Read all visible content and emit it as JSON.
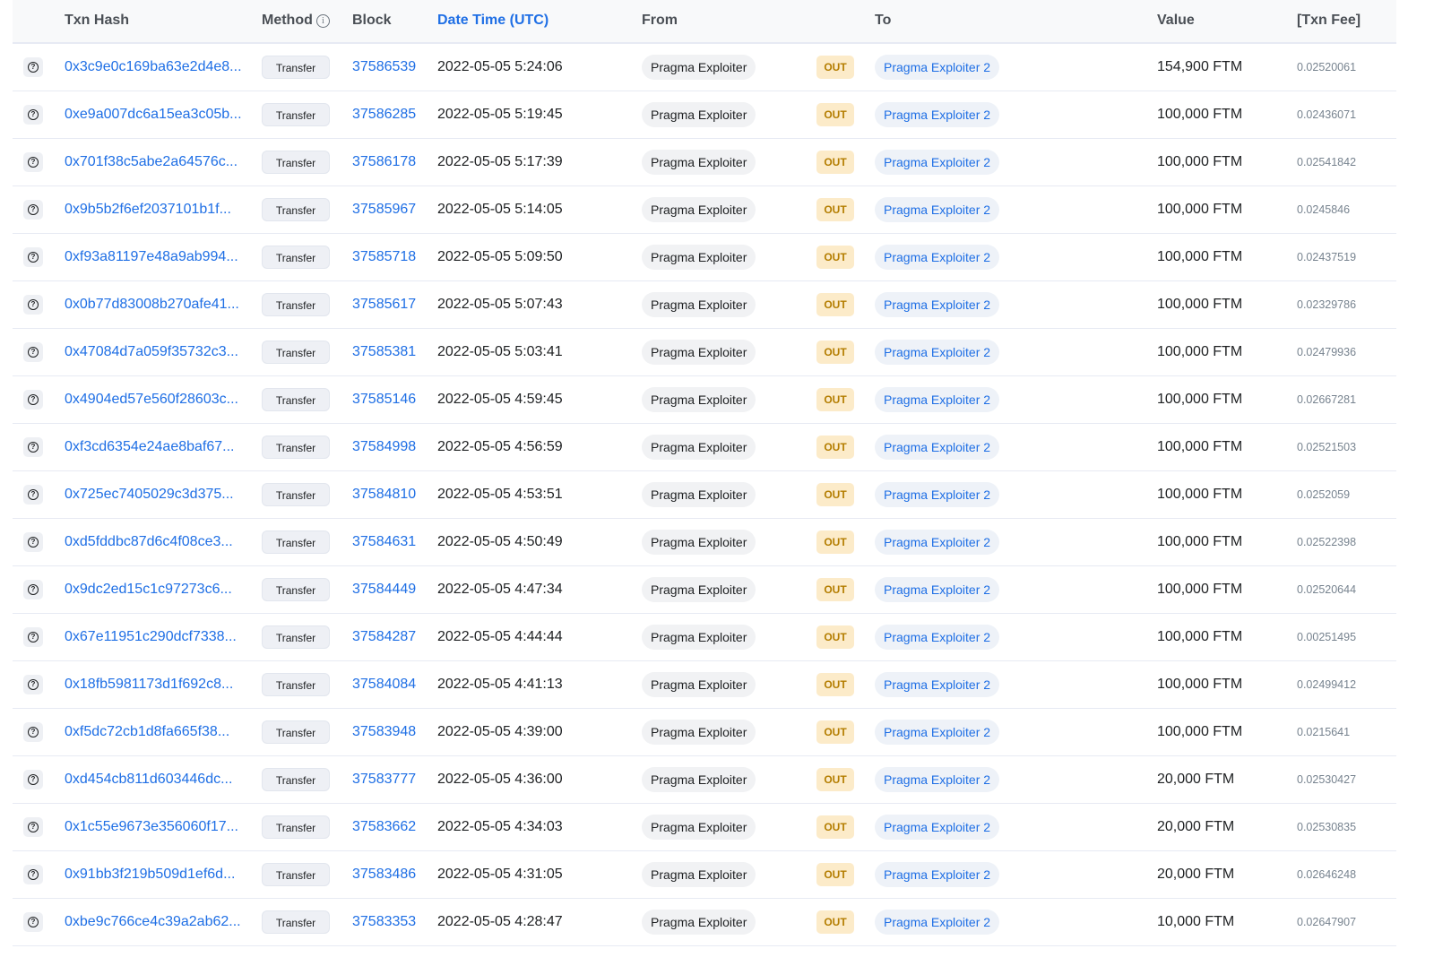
{
  "columns": {
    "txn_hash": "Txn Hash",
    "method": "Method",
    "block": "Block",
    "date_time": "Date Time (UTC)",
    "from": "From",
    "to": "To",
    "value": "Value",
    "txn_fee": "[Txn Fee]"
  },
  "icons": {
    "row_preview": "eye-question-icon",
    "method_info": "info-icon"
  },
  "colors": {
    "link": "#1f6fe5",
    "out_badge_bg": "#fcebc9",
    "out_badge_text": "#b47d00",
    "header_bg": "#f8f9fa",
    "row_border": "#e7eaf3"
  },
  "rows": [
    {
      "hash": "0x3c9e0c169ba63e2d4e8...",
      "method": "Transfer",
      "block": "37586539",
      "datetime": "2022-05-05 5:24:06",
      "from": "Pragma Exploiter",
      "direction": "OUT",
      "to": "Pragma Exploiter 2",
      "value": "154,900 FTM",
      "fee": "0.02520061"
    },
    {
      "hash": "0xe9a007dc6a15ea3c05b...",
      "method": "Transfer",
      "block": "37586285",
      "datetime": "2022-05-05 5:19:45",
      "from": "Pragma Exploiter",
      "direction": "OUT",
      "to": "Pragma Exploiter 2",
      "value": "100,000 FTM",
      "fee": "0.02436071"
    },
    {
      "hash": "0x701f38c5abe2a64576c...",
      "method": "Transfer",
      "block": "37586178",
      "datetime": "2022-05-05 5:17:39",
      "from": "Pragma Exploiter",
      "direction": "OUT",
      "to": "Pragma Exploiter 2",
      "value": "100,000 FTM",
      "fee": "0.02541842"
    },
    {
      "hash": "0x9b5b2f6ef2037101b1f...",
      "method": "Transfer",
      "block": "37585967",
      "datetime": "2022-05-05 5:14:05",
      "from": "Pragma Exploiter",
      "direction": "OUT",
      "to": "Pragma Exploiter 2",
      "value": "100,000 FTM",
      "fee": "0.0245846"
    },
    {
      "hash": "0xf93a81197e48a9ab994...",
      "method": "Transfer",
      "block": "37585718",
      "datetime": "2022-05-05 5:09:50",
      "from": "Pragma Exploiter",
      "direction": "OUT",
      "to": "Pragma Exploiter 2",
      "value": "100,000 FTM",
      "fee": "0.02437519"
    },
    {
      "hash": "0x0b77d83008b270afe41...",
      "method": "Transfer",
      "block": "37585617",
      "datetime": "2022-05-05 5:07:43",
      "from": "Pragma Exploiter",
      "direction": "OUT",
      "to": "Pragma Exploiter 2",
      "value": "100,000 FTM",
      "fee": "0.02329786"
    },
    {
      "hash": "0x47084d7a059f35732c3...",
      "method": "Transfer",
      "block": "37585381",
      "datetime": "2022-05-05 5:03:41",
      "from": "Pragma Exploiter",
      "direction": "OUT",
      "to": "Pragma Exploiter 2",
      "value": "100,000 FTM",
      "fee": "0.02479936"
    },
    {
      "hash": "0x4904ed57e560f28603c...",
      "method": "Transfer",
      "block": "37585146",
      "datetime": "2022-05-05 4:59:45",
      "from": "Pragma Exploiter",
      "direction": "OUT",
      "to": "Pragma Exploiter 2",
      "value": "100,000 FTM",
      "fee": "0.02667281"
    },
    {
      "hash": "0xf3cd6354e24ae8baf67...",
      "method": "Transfer",
      "block": "37584998",
      "datetime": "2022-05-05 4:56:59",
      "from": "Pragma Exploiter",
      "direction": "OUT",
      "to": "Pragma Exploiter 2",
      "value": "100,000 FTM",
      "fee": "0.02521503"
    },
    {
      "hash": "0x725ec7405029c3d375...",
      "method": "Transfer",
      "block": "37584810",
      "datetime": "2022-05-05 4:53:51",
      "from": "Pragma Exploiter",
      "direction": "OUT",
      "to": "Pragma Exploiter 2",
      "value": "100,000 FTM",
      "fee": "0.0252059"
    },
    {
      "hash": "0xd5fddbc87d6c4f08ce3...",
      "method": "Transfer",
      "block": "37584631",
      "datetime": "2022-05-05 4:50:49",
      "from": "Pragma Exploiter",
      "direction": "OUT",
      "to": "Pragma Exploiter 2",
      "value": "100,000 FTM",
      "fee": "0.02522398"
    },
    {
      "hash": "0x9dc2ed15c1c97273c6...",
      "method": "Transfer",
      "block": "37584449",
      "datetime": "2022-05-05 4:47:34",
      "from": "Pragma Exploiter",
      "direction": "OUT",
      "to": "Pragma Exploiter 2",
      "value": "100,000 FTM",
      "fee": "0.02520644"
    },
    {
      "hash": "0x67e11951c290dcf7338...",
      "method": "Transfer",
      "block": "37584287",
      "datetime": "2022-05-05 4:44:44",
      "from": "Pragma Exploiter",
      "direction": "OUT",
      "to": "Pragma Exploiter 2",
      "value": "100,000 FTM",
      "fee": "0.00251495"
    },
    {
      "hash": "0x18fb5981173d1f692c8...",
      "method": "Transfer",
      "block": "37584084",
      "datetime": "2022-05-05 4:41:13",
      "from": "Pragma Exploiter",
      "direction": "OUT",
      "to": "Pragma Exploiter 2",
      "value": "100,000 FTM",
      "fee": "0.02499412"
    },
    {
      "hash": "0xf5dc72cb1d8fa665f38...",
      "method": "Transfer",
      "block": "37583948",
      "datetime": "2022-05-05 4:39:00",
      "from": "Pragma Exploiter",
      "direction": "OUT",
      "to": "Pragma Exploiter 2",
      "value": "100,000 FTM",
      "fee": "0.0215641"
    },
    {
      "hash": "0xd454cb811d603446dc...",
      "method": "Transfer",
      "block": "37583777",
      "datetime": "2022-05-05 4:36:00",
      "from": "Pragma Exploiter",
      "direction": "OUT",
      "to": "Pragma Exploiter 2",
      "value": "20,000 FTM",
      "fee": "0.02530427"
    },
    {
      "hash": "0x1c55e9673e356060f17...",
      "method": "Transfer",
      "block": "37583662",
      "datetime": "2022-05-05 4:34:03",
      "from": "Pragma Exploiter",
      "direction": "OUT",
      "to": "Pragma Exploiter 2",
      "value": "20,000 FTM",
      "fee": "0.02530835"
    },
    {
      "hash": "0x91bb3f219b509d1ef6d...",
      "method": "Transfer",
      "block": "37583486",
      "datetime": "2022-05-05 4:31:05",
      "from": "Pragma Exploiter",
      "direction": "OUT",
      "to": "Pragma Exploiter 2",
      "value": "20,000 FTM",
      "fee": "0.02646248"
    },
    {
      "hash": "0xbe9c766ce4c39a2ab62...",
      "method": "Transfer",
      "block": "37583353",
      "datetime": "2022-05-05 4:28:47",
      "from": "Pragma Exploiter",
      "direction": "OUT",
      "to": "Pragma Exploiter 2",
      "value": "10,000 FTM",
      "fee": "0.02647907"
    }
  ]
}
